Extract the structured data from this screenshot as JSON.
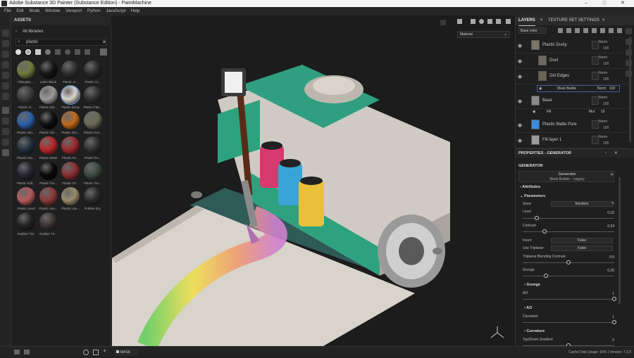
{
  "window": {
    "title": "Adobe Substance 3D Painter (Substance Edition) - PaintMachine",
    "controls": [
      "–",
      "□",
      "✕"
    ]
  },
  "menu": [
    "File",
    "Edit",
    "Mode",
    "Window",
    "Viewport",
    "Python",
    "JavaScript",
    "Help"
  ],
  "assets": {
    "panel_title": "ASSETS",
    "library": "All libraries",
    "search_value": "plastic",
    "items": [
      {
        "label": "Fiberglas ...",
        "color": "#6f7a3c"
      },
      {
        "label": "Latex Black",
        "color": "#151515"
      },
      {
        "label": "Plastic Ar...",
        "color": "#2e2e2e"
      },
      {
        "label": "Plastic Ar...",
        "color": "#292929"
      },
      {
        "label": "Plastic Ar...",
        "color": "#3a3a3a"
      },
      {
        "label": "Plastic Dirt...",
        "color": "#9a9a9a"
      },
      {
        "label": "Plastic Dusty",
        "color": "#d8d4cc"
      },
      {
        "label": "Plastic Fab...",
        "color": "#303030"
      },
      {
        "label": "Plastic Glo...",
        "color": "#2d5fa8"
      },
      {
        "label": "Plastic Glo...",
        "color": "#0e0e0e"
      },
      {
        "label": "Plastic Glo...",
        "color": "#c06a1c"
      },
      {
        "label": "Plastic Gra...",
        "color": "#6a6a58"
      },
      {
        "label": "Plastic Hex...",
        "color": "#22303e"
      },
      {
        "label": "Plastic Matte",
        "color": "#b8282a"
      },
      {
        "label": "Plastic Ro...",
        "color": "#9c2a30"
      },
      {
        "label": "Plastic Ru...",
        "color": "#2e2e2e"
      },
      {
        "label": "Plastic Soft...",
        "color": "#262630"
      },
      {
        "label": "Plastic Tra...",
        "color": "#0a0a0a"
      },
      {
        "label": "Plastic Pri...",
        "color": "#8a2e32"
      },
      {
        "label": "Plastic Tex...",
        "color": "#3c4a40"
      },
      {
        "label": "Plastic Used",
        "color": "#b45a5a"
      },
      {
        "label": "Plastic Use...",
        "color": "#8a3a3a"
      },
      {
        "label": "Plastic Use...",
        "color": "#9a8a6a"
      },
      {
        "label": "Rubber Dry",
        "color": "#2a2a2a"
      },
      {
        "label": "Rubber Tire",
        "color": "#232323"
      },
      {
        "label": "Rubber Tir...",
        "color": "#3a3232"
      }
    ]
  },
  "viewport": {
    "material_dropdown": "Material",
    "mask_label": "MASK"
  },
  "layers": {
    "tab_layers": "LAYERS",
    "tab_texture": "TEXTURE SET SETTINGS",
    "channel_select": "Base color",
    "rows": [
      {
        "name": "Plastic Dusty",
        "blend": "Norm",
        "opacity": "100",
        "thumb": "#7a7668"
      },
      {
        "name": "Dust",
        "blend": "Norm",
        "opacity": "100",
        "thumb": "#6c6a60"
      },
      {
        "name": "Dirt Edges",
        "blend": "Norm",
        "opacity": "100",
        "thumb": "#6a6356"
      },
      {
        "name": "Base",
        "blend": "Norm",
        "opacity": "100",
        "thumb": "#8a8a8a"
      },
      {
        "name": "Plastic Matte Pure",
        "blend": "Norm",
        "opacity": "100",
        "thumb": "#3a8adf"
      },
      {
        "name": "Fill layer 1",
        "blend": "Norm",
        "opacity": "100",
        "thumb": "#9a9a9a"
      }
    ],
    "mask_builder": {
      "name": "Mask Builde",
      "blend": "Norm",
      "opacity": "100"
    },
    "fill_sub": {
      "name": "Fill",
      "blend": "Mul",
      "opacity": "15"
    }
  },
  "properties": {
    "title": "PROPERTIES - GENERATOR",
    "section_generator": "GENERATOR",
    "generator_label": "Generator",
    "generator_value": "Mask Builder - Legacy",
    "attributes": "Attributes",
    "parameters": "Parameters",
    "seed_label": "Seed",
    "seed_value": "Random",
    "level_label": "Level",
    "level_value": "0.15",
    "level_fill": 0.15,
    "contrast_label": "Contrast",
    "contrast_value": "0.24",
    "contrast_fill": 0.24,
    "invert_label": "Invert",
    "invert_value": "False",
    "triplanar_label": "Use Triplanar",
    "triplanar_value": "False",
    "blend_contrast_label": "Triplanar Blending Contrast",
    "blend_contrast_value": "0.5",
    "blend_contrast_fill": 0.5,
    "grunge_label": "Grunge",
    "grunge_value": "0.25",
    "grunge_fill": 0.25,
    "sec_grunge": "Grunge",
    "ao_label": "AO",
    "ao_value": "1",
    "ao_fill": 1.0,
    "sec_ao": "AO",
    "curvature_label": "Curvature",
    "curvature_value": "1",
    "curvature_fill": 1.0,
    "sec_curvature": "Curvature",
    "topdown_label": "Top/Down Gradient",
    "topdown_value": "0",
    "topdown_fill": 0.5
  },
  "status": "Cache Disk Usage:   36% | Version: 7.3.0"
}
